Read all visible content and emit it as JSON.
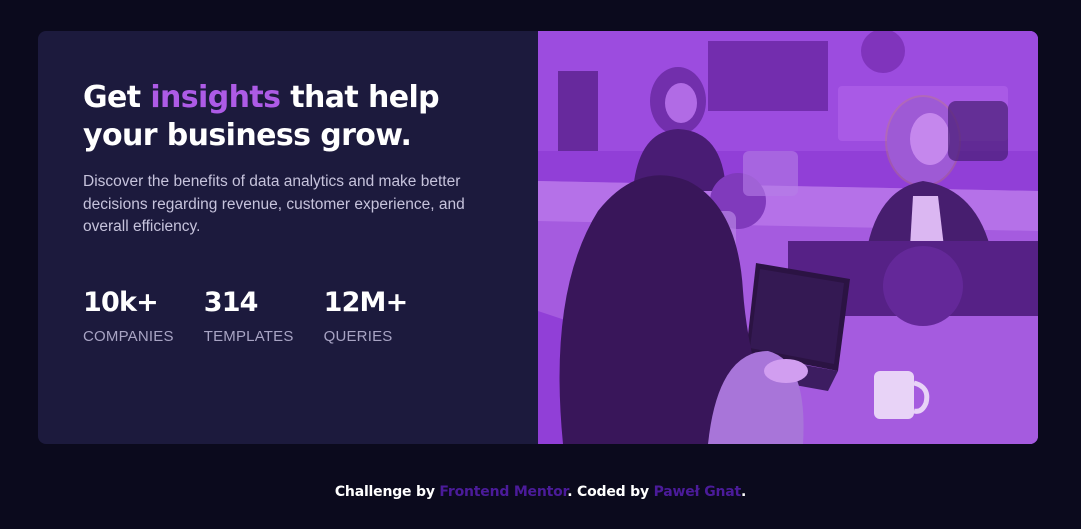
{
  "hero": {
    "headline_before": "Get ",
    "headline_accent": "insights",
    "headline_after": " that help your business grow.",
    "description": "Discover the benefits of data analytics and make better decisions regarding revenue, customer experience, and overall efficiency."
  },
  "stats": [
    {
      "value": "10k+",
      "label": "COMPANIES"
    },
    {
      "value": "314",
      "label": "TEMPLATES"
    },
    {
      "value": "12M+",
      "label": "QUERIES"
    }
  ],
  "footer": {
    "prefix": "Challenge by ",
    "link1": "Frontend Mentor",
    "middle": ". Coded by ",
    "link2": "Paweł Gnat",
    "suffix": "."
  },
  "colors": {
    "page_background": "#0b0a1d",
    "card_background": "#1c1a3d",
    "accent": "#ad5be6",
    "image_overlay": "#8b3ad4",
    "footer_link": "#4b1b9a"
  }
}
